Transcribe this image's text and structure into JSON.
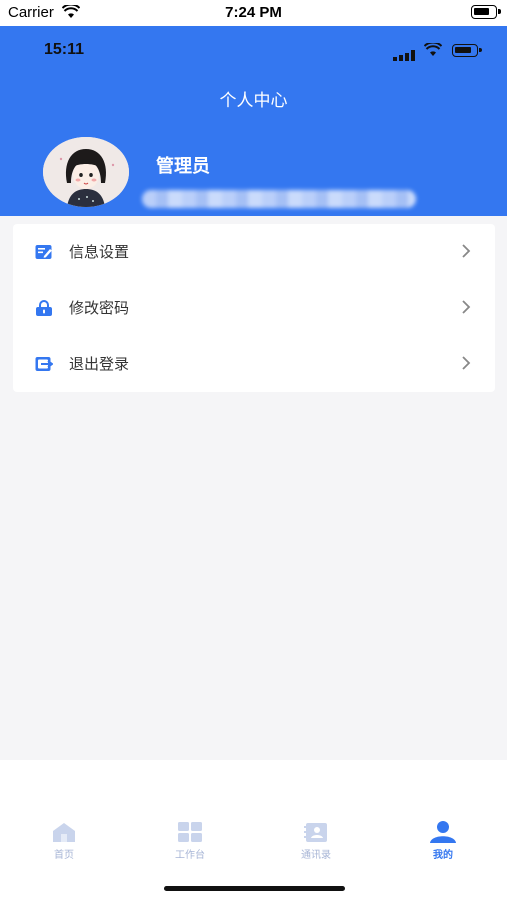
{
  "simulator": {
    "carrier": "Carrier",
    "time": "7:24 PM"
  },
  "app_status": {
    "time": "15:11"
  },
  "header": {
    "title": "个人中心"
  },
  "profile": {
    "name": "管理员"
  },
  "menu": {
    "items": [
      {
        "label": "信息设置",
        "icon": "edit-icon"
      },
      {
        "label": "修改密码",
        "icon": "lock-icon"
      },
      {
        "label": "退出登录",
        "icon": "logout-icon"
      }
    ]
  },
  "tabbar": {
    "items": [
      {
        "label": "首页",
        "icon": "home-icon",
        "active": false
      },
      {
        "label": "工作台",
        "icon": "grid-icon",
        "active": false
      },
      {
        "label": "通讯录",
        "icon": "contacts-icon",
        "active": false
      },
      {
        "label": "我的",
        "icon": "user-icon",
        "active": true
      }
    ]
  },
  "colors": {
    "primary": "#3477f0",
    "background": "#f5f5f7",
    "tab_inactive": "#a7b5d6"
  }
}
